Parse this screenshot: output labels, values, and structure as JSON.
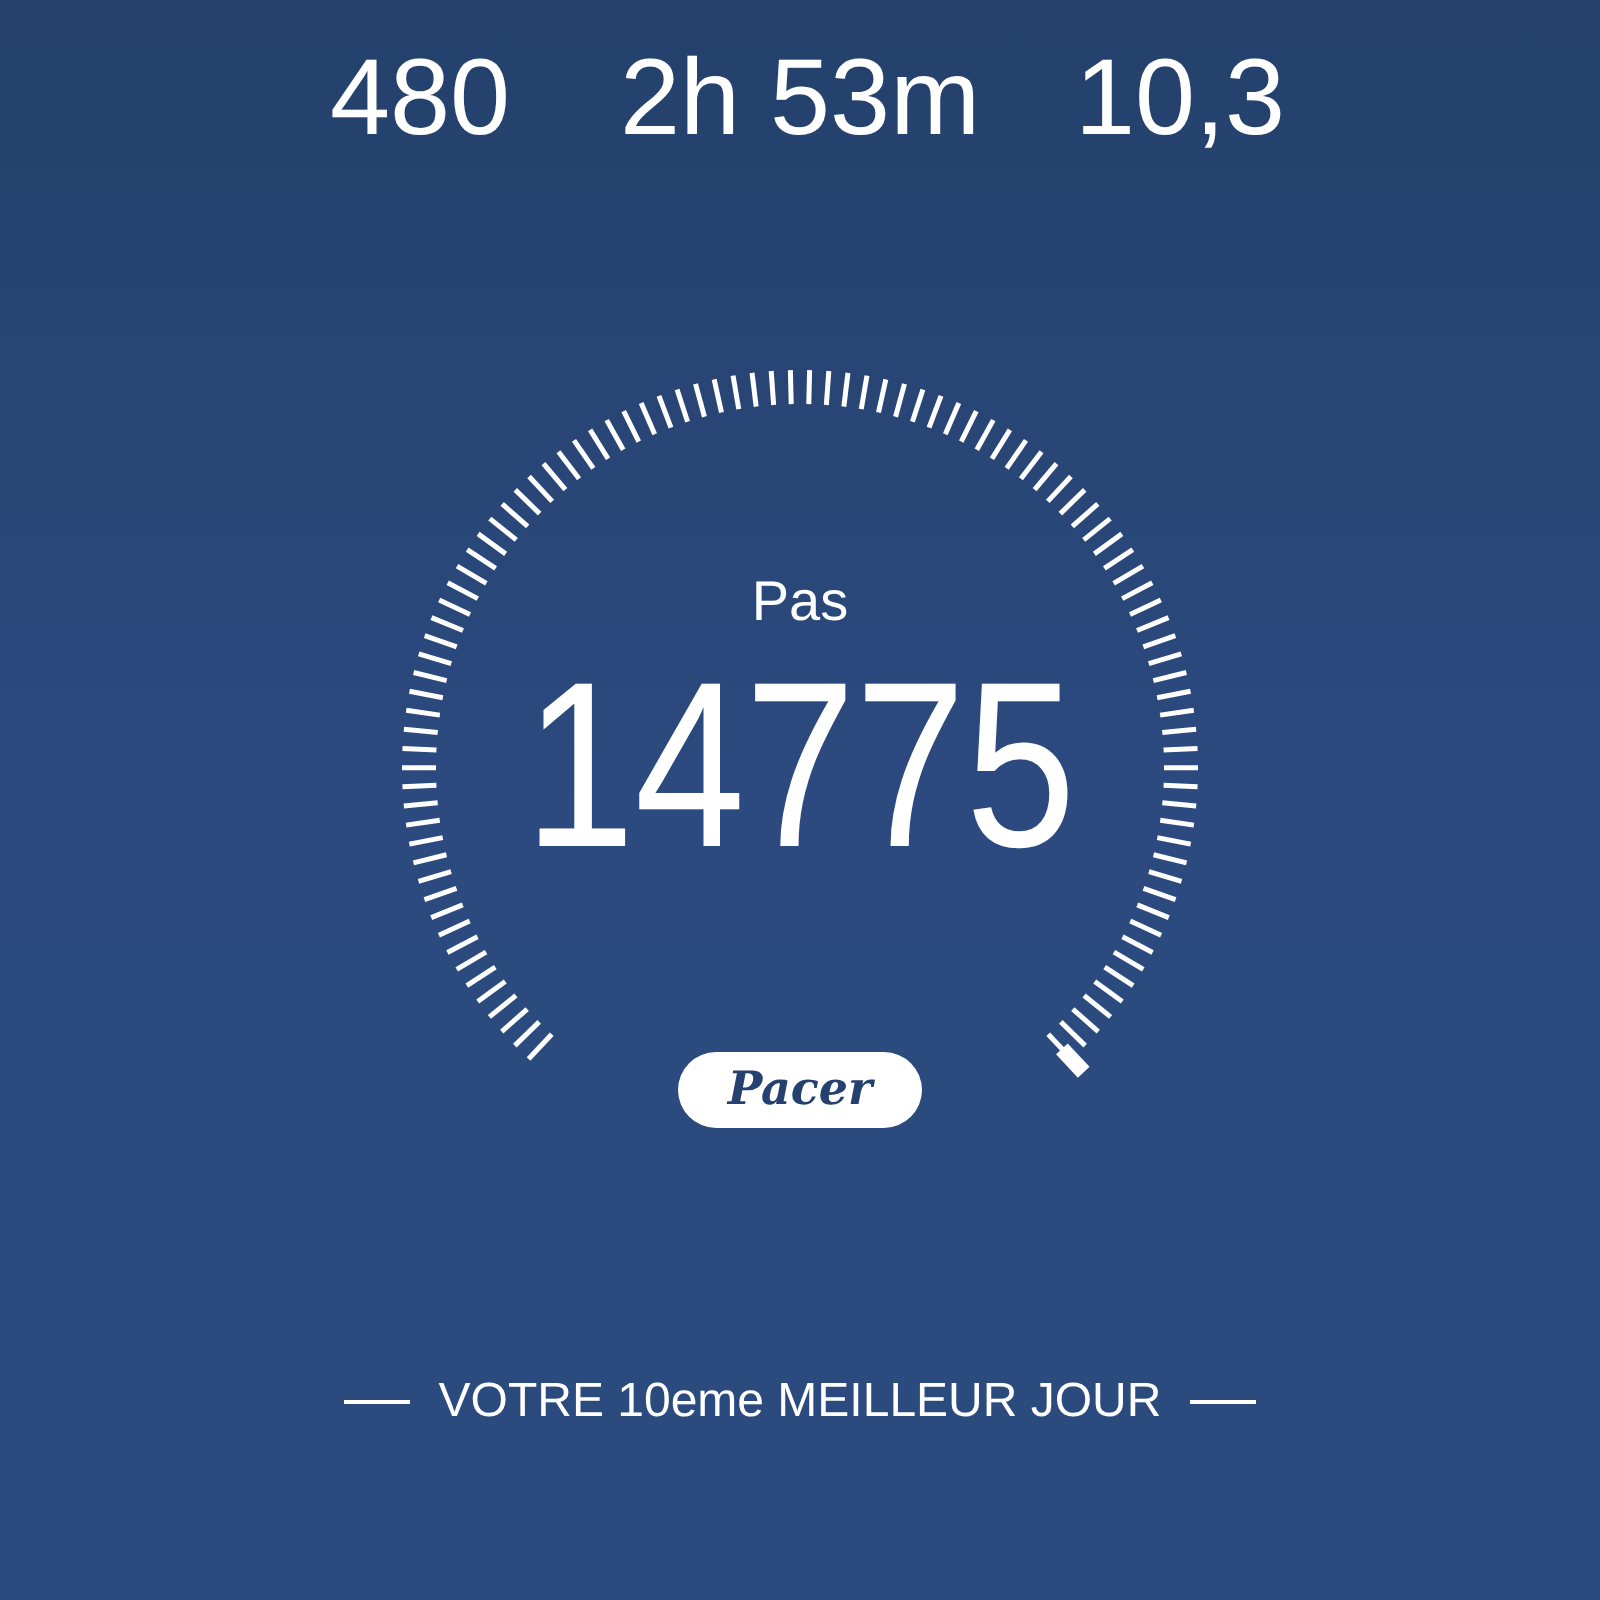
{
  "stats": [
    {
      "value": "480"
    },
    {
      "value": "2h 53m"
    },
    {
      "value": "10,3"
    }
  ],
  "gauge": {
    "label": "Pas",
    "value": "14775"
  },
  "logo": {
    "text": "Pacer"
  },
  "footer": {
    "text": "VOTRE 10eme MEILLEUR JOUR"
  }
}
